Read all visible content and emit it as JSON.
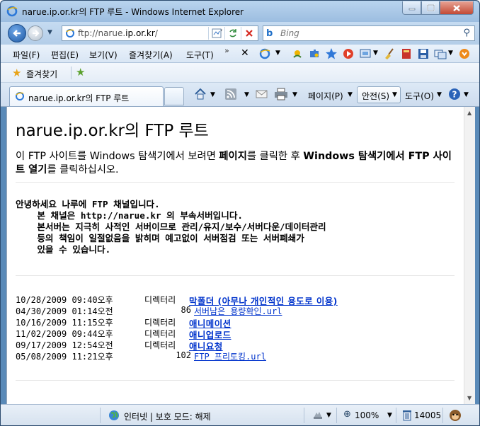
{
  "window": {
    "title": "narue.ip.or.kr의 FTP 루트 - Windows Internet Explorer"
  },
  "address": {
    "prefix": "ftp://narue.",
    "host": "ip.or.kr",
    "suffix": "/"
  },
  "search": {
    "placeholder": "Bing"
  },
  "menu": {
    "file": "파일(F)",
    "edit": "편집(E)",
    "view": "보기(V)",
    "favorites": "즐겨찾기(A)",
    "tools": "도구(T)"
  },
  "favbar": {
    "label": "즐겨찾기"
  },
  "tab": {
    "label": "narue.ip.or.kr의 FTP 루트"
  },
  "command": {
    "page": "페이지(P)",
    "safety": "안전(S)",
    "tools": "도구(O)"
  },
  "page": {
    "heading": "narue.ip.or.kr의 FTP 루트",
    "intro_1": "이 FTP 사이트를 Windows 탐색기에서 보려면 ",
    "intro_b1": "페이지",
    "intro_2": "를 클릭한 후 ",
    "intro_b2": "Windows 탐색기에서 FTP 사이트 열기",
    "intro_3": "를 클릭하십시오.",
    "message": "안녕하세요 나루에 FTP 채널입니다.\n    본 채널은 http://narue.kr 의 부속서버입니다.\n    본서버는 지극히 사적인 서버이므로 관리/유지/보수/서버다운/데이터관리\n    등의 책임이 일절없음을 밝히며 예고없이 서버점검 또는 서버폐쇄가\n    있을 수 있습니다."
  },
  "listing": [
    {
      "date": "10/28/2009 09:40오후",
      "kind": "디렉터리",
      "size": "",
      "name": "막폴더 (아무나 개인적인 용도로 이용)",
      "is_dir": true
    },
    {
      "date": "04/30/2009 01:14오전",
      "kind": "",
      "size": "86",
      "name": "서버남은 용량확인.url",
      "is_dir": false
    },
    {
      "date": "10/16/2009 11:15오후",
      "kind": "디렉터리",
      "size": "",
      "name": "애니메이션",
      "is_dir": true
    },
    {
      "date": "11/02/2009 09:44오후",
      "kind": "디렉터리",
      "size": "",
      "name": "애니업로드",
      "is_dir": true
    },
    {
      "date": "09/17/2009 12:54오전",
      "kind": "디렉터리",
      "size": "",
      "name": "애니요청",
      "is_dir": true
    },
    {
      "date": "05/08/2009 11:21오후",
      "kind": "",
      "size": "102",
      "name": "FTP 프리토킹.url",
      "is_dir": false
    }
  ],
  "status": {
    "zone": "인터넷 | 보호 모드: 해제",
    "zoom": "100%",
    "counter": "14005"
  },
  "colors": {
    "link": "#0033cc",
    "titlebar": "#b9d4ee",
    "close_button": "#c24a35"
  }
}
